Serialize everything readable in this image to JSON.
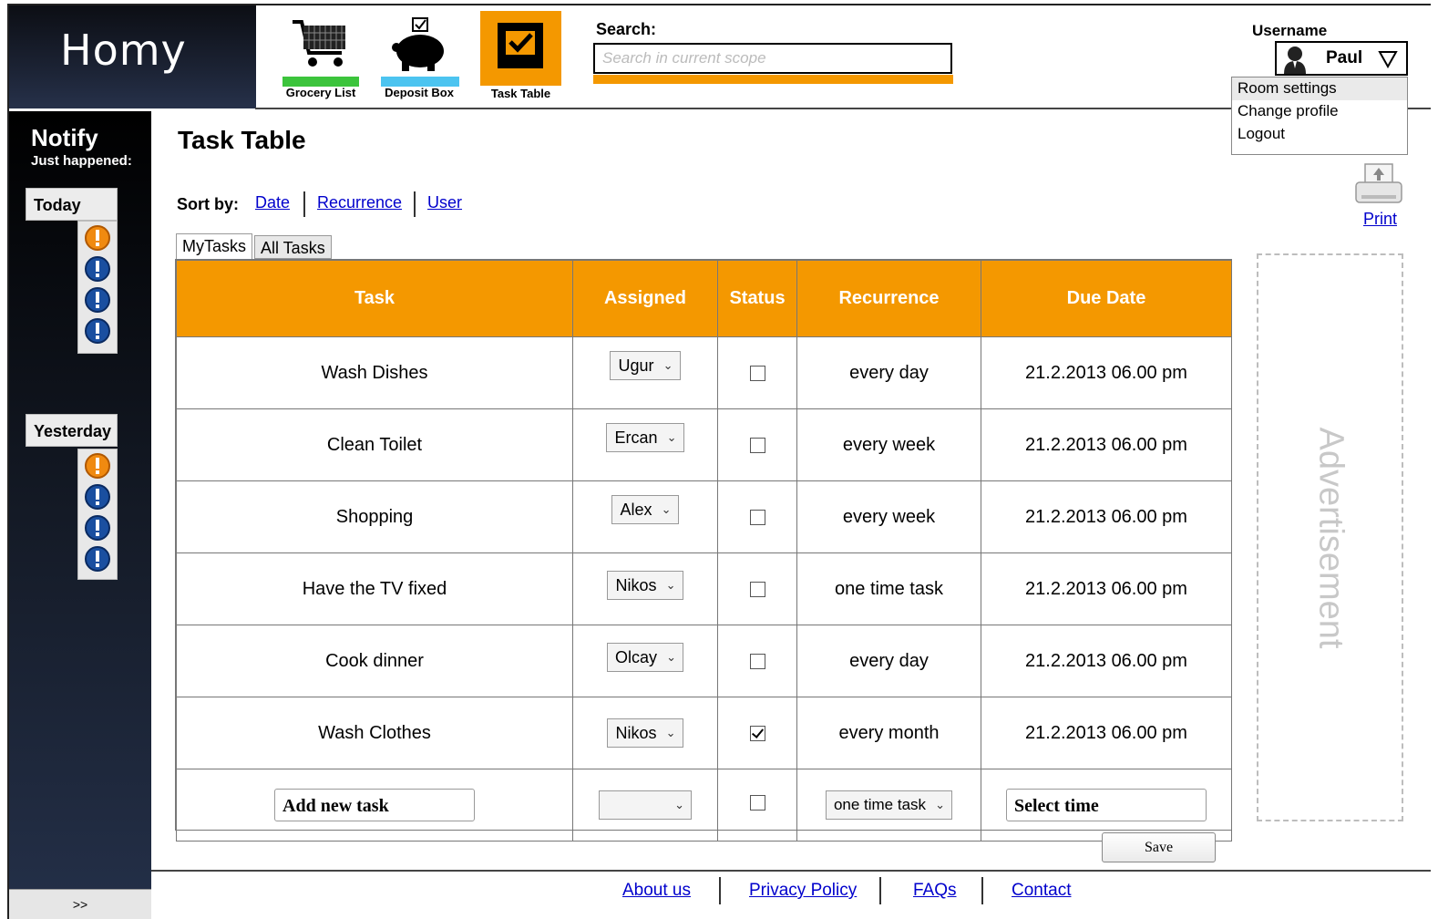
{
  "app": {
    "logo_text": "Homy"
  },
  "nav": {
    "items": [
      {
        "label": "Grocery List",
        "icon": "shopping-cart-icon",
        "bar_color": "#3cc43c"
      },
      {
        "label": "Deposit Box",
        "icon": "piggy-bank-icon",
        "bar_color": "#4cc4f0"
      },
      {
        "label": "Task Table",
        "icon": "checkbox-icon",
        "bar_color": "#f49800"
      }
    ]
  },
  "search": {
    "label": "Search:",
    "placeholder": "Search in current scope"
  },
  "user": {
    "label": "Username",
    "name": "Paul",
    "menu": [
      "Room settings",
      "Change profile",
      "Logout"
    ]
  },
  "sidebar": {
    "title": "Notify",
    "subtitle": "Just happened:",
    "groups": [
      {
        "label": "Today",
        "icons": [
          "warning-icon",
          "info-icon",
          "info-icon",
          "info-icon"
        ]
      },
      {
        "label": "Yesterday",
        "icons": [
          "warning-icon",
          "info-icon",
          "info-icon",
          "info-icon"
        ]
      }
    ],
    "expand_label": ">>"
  },
  "main": {
    "title": "Task Table",
    "sort_label": "Sort by:",
    "sort_links": [
      "Date",
      "Recurrence",
      "User"
    ],
    "tabs": [
      "MyTasks",
      "All Tasks"
    ],
    "columns": [
      "Task",
      "Assigned",
      "Status",
      "Recurrence",
      "Due Date"
    ],
    "rows": [
      {
        "task": "Wash Dishes",
        "assigned": "Ugur",
        "done": false,
        "recurrence": "every day",
        "due": "21.2.2013 06.00 pm"
      },
      {
        "task": "Clean Toilet",
        "assigned": "Ercan",
        "done": false,
        "recurrence": "every week",
        "due": "21.2.2013 06.00 pm"
      },
      {
        "task": "Shopping",
        "assigned": "Alex",
        "done": false,
        "recurrence": "every week",
        "due": "21.2.2013 06.00 pm"
      },
      {
        "task": "Have the TV fixed",
        "assigned": "Nikos",
        "done": false,
        "recurrence": "one time task",
        "due": "21.2.2013 06.00 pm"
      },
      {
        "task": "Cook dinner",
        "assigned": "Olcay",
        "done": false,
        "recurrence": "every day",
        "due": "21.2.2013 06.00 pm"
      },
      {
        "task": "Wash Clothes",
        "assigned": "Nikos",
        "done": true,
        "recurrence": "every month",
        "due": "21.2.2013 06.00 pm"
      }
    ],
    "new_row": {
      "task_value": "Add new task",
      "assigned": "",
      "recurrence": "one time task",
      "time_value": "Select time"
    },
    "save_label": "Save"
  },
  "right": {
    "print_label": "Print",
    "ad_label": "Advertisement"
  },
  "footer": {
    "links": [
      "About us",
      "Privacy Policy",
      "FAQs",
      "Contact"
    ]
  }
}
